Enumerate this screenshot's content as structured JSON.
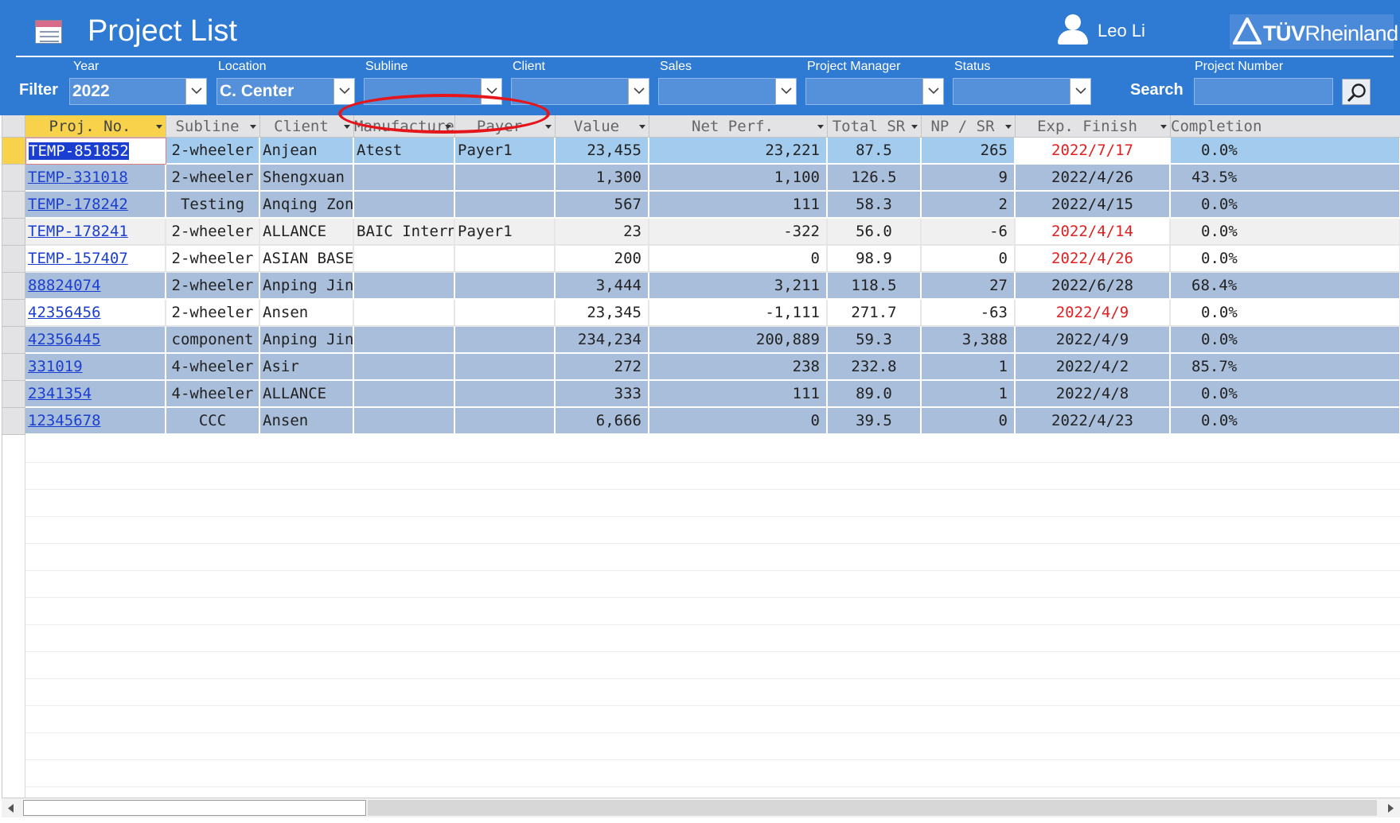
{
  "header": {
    "title": "Project List",
    "user_name": "Leo Li",
    "brand": {
      "bold": "TÜV",
      "light": "Rheinland"
    },
    "app_icon": "table-form-icon",
    "user_icon": "user-icon",
    "search_icon": "magnifier-icon"
  },
  "filter": {
    "label": "Filter",
    "search_label": "Search",
    "fields": {
      "year": {
        "label": "Year",
        "value": "2022"
      },
      "location": {
        "label": "Location",
        "value": "C. Center"
      },
      "subline": {
        "label": "Subline",
        "value": ""
      },
      "client": {
        "label": "Client",
        "value": ""
      },
      "sales": {
        "label": "Sales",
        "value": ""
      },
      "project_manager": {
        "label": "Project Manager",
        "value": ""
      },
      "status": {
        "label": "Status",
        "value": ""
      }
    },
    "project_number": {
      "label": "Project Number",
      "value": ""
    }
  },
  "table": {
    "columns": [
      "Proj. No.",
      "Subline",
      "Client",
      "Manufacture",
      "Payer",
      "Value",
      "Net Perf.",
      "Total SR",
      "NP / SR",
      "Exp. Finish",
      "Completion"
    ],
    "rows": [
      {
        "proj": "TEMP-851852",
        "subline": "2-wheeler",
        "client": "Anjean",
        "manufacturer": "Atest",
        "payer": "Payer1",
        "value": "23,455",
        "net_perf": "23,221",
        "total_sr": "87.5",
        "np_sr": "265",
        "exp_finish": "2022/7/17",
        "completion": "0.0%"
      },
      {
        "proj": "TEMP-331018",
        "subline": "2-wheeler",
        "client": "Shengxuan",
        "manufacturer": "",
        "payer": "",
        "value": "1,300",
        "net_perf": "1,100",
        "total_sr": "126.5",
        "np_sr": "9",
        "exp_finish": "2022/4/26",
        "completion": "43.5%"
      },
      {
        "proj": "TEMP-178242",
        "subline": "Testing",
        "client": "Anqing Zongy",
        "manufacturer": "",
        "payer": "",
        "value": "567",
        "net_perf": "111",
        "total_sr": "58.3",
        "np_sr": "2",
        "exp_finish": "2022/4/15",
        "completion": "0.0%"
      },
      {
        "proj": "TEMP-178241",
        "subline": "2-wheeler",
        "client": "ALLANCE",
        "manufacturer": "BAIC Internat",
        "payer": "Payer1",
        "value": "23",
        "net_perf": "-322",
        "total_sr": "56.0",
        "np_sr": "-6",
        "exp_finish": "2022/4/14",
        "completion": "0.0%"
      },
      {
        "proj": "TEMP-157407",
        "subline": "2-wheeler",
        "client": "ASIAN BASE",
        "manufacturer": "",
        "payer": "",
        "value": "200",
        "net_perf": "0",
        "total_sr": "98.9",
        "np_sr": "0",
        "exp_finish": "2022/4/26",
        "completion": "0.0%"
      },
      {
        "proj": "88824074",
        "subline": "2-wheeler",
        "client": "Anping Jinlc",
        "manufacturer": "",
        "payer": "",
        "value": "3,444",
        "net_perf": "3,211",
        "total_sr": "118.5",
        "np_sr": "27",
        "exp_finish": "2022/6/28",
        "completion": "68.4%"
      },
      {
        "proj": "42356456",
        "subline": "2-wheeler",
        "client": "Ansen",
        "manufacturer": "",
        "payer": "",
        "value": "23,345",
        "net_perf": "-1,111",
        "total_sr": "271.7",
        "np_sr": "-63",
        "exp_finish": "2022/4/9",
        "completion": "0.0%"
      },
      {
        "proj": "42356445",
        "subline": "component",
        "client": "Anping Jinlc",
        "manufacturer": "",
        "payer": "",
        "value": "234,234",
        "net_perf": "200,889",
        "total_sr": "59.3",
        "np_sr": "3,388",
        "exp_finish": "2022/4/9",
        "completion": "0.0%"
      },
      {
        "proj": "331019",
        "subline": "4-wheeler",
        "client": "Asir",
        "manufacturer": "",
        "payer": "",
        "value": "272",
        "net_perf": "238",
        "total_sr": "232.8",
        "np_sr": "1",
        "exp_finish": "2022/4/2",
        "completion": "85.7%"
      },
      {
        "proj": "2341354",
        "subline": "4-wheeler",
        "client": "ALLANCE",
        "manufacturer": "",
        "payer": "",
        "value": "333",
        "net_perf": "111",
        "total_sr": "89.0",
        "np_sr": "1",
        "exp_finish": "2022/4/8",
        "completion": "0.0%"
      },
      {
        "proj": "12345678",
        "subline": "CCC",
        "client": "Ansen",
        "manufacturer": "",
        "payer": "",
        "value": "6,666",
        "net_perf": "0",
        "total_sr": "39.5",
        "np_sr": "0",
        "exp_finish": "2022/4/23",
        "completion": "0.0%"
      }
    ]
  },
  "colors": {
    "header_bg": "#2f7bd3",
    "active_header": "#f7d24a",
    "row_blue": "#a9bedb",
    "row_current": "#a2cbee",
    "link": "#1a3fd0",
    "overdue_red": "#e02020",
    "annotation": "#e4161b"
  }
}
